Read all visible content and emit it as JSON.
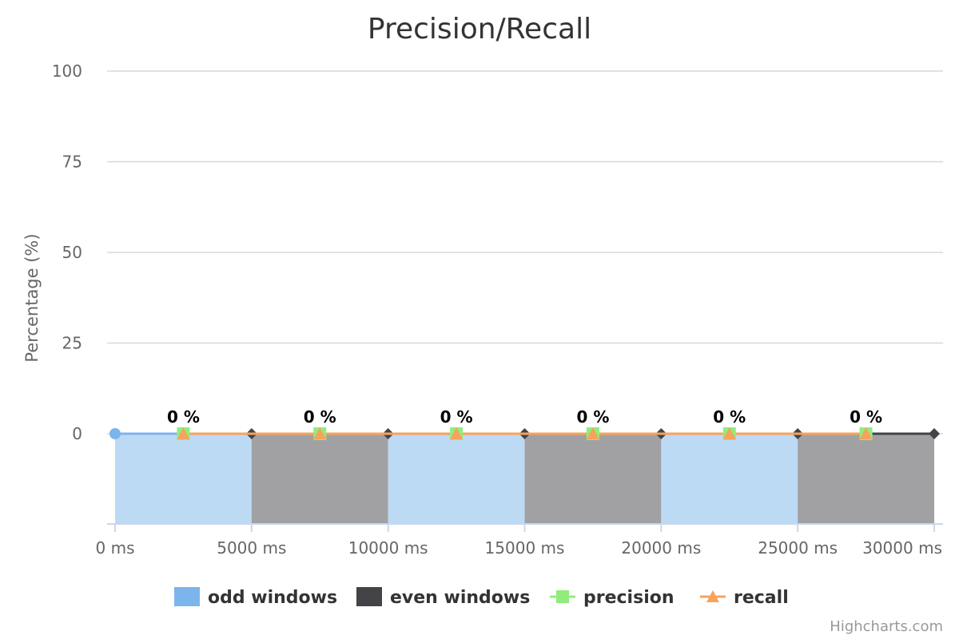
{
  "chart_data": {
    "type": "area",
    "title": "Precision/Recall",
    "ylabel": "Percentage (%)",
    "xlabel": "",
    "ylim": [
      0,
      100
    ],
    "xlim": [
      0,
      30000
    ],
    "y_ticks": [
      0,
      25,
      50,
      75,
      100
    ],
    "x_ticks": [
      0,
      5000,
      10000,
      15000,
      20000,
      25000,
      30000
    ],
    "x_unit": "ms",
    "x_tick_labels": [
      "0 ms",
      "5000 ms",
      "10000 ms",
      "15000 ms",
      "20000 ms",
      "25000 ms",
      "30000 ms"
    ],
    "grid": true,
    "legend_position": "bottom-center",
    "windows": [
      {
        "series": "odd windows",
        "start": 0,
        "end": 5000
      },
      {
        "series": "even windows",
        "start": 5000,
        "end": 10000
      },
      {
        "series": "odd windows",
        "start": 10000,
        "end": 15000
      },
      {
        "series": "even windows",
        "start": 15000,
        "end": 20000
      },
      {
        "series": "odd windows",
        "start": 20000,
        "end": 25000
      },
      {
        "series": "even windows",
        "start": 25000,
        "end": 30000
      }
    ],
    "window_points": [
      {
        "series": "odd windows",
        "x": 0,
        "y": 0
      },
      {
        "series": "even windows",
        "x": 5000,
        "y": 0
      },
      {
        "series": "even windows",
        "x": 10000,
        "y": 0
      },
      {
        "series": "even windows",
        "x": 15000,
        "y": 0
      },
      {
        "series": "even windows",
        "x": 20000,
        "y": 0
      },
      {
        "series": "even windows",
        "x": 25000,
        "y": 0
      },
      {
        "series": "even windows",
        "x": 30000,
        "y": 0
      }
    ],
    "series": [
      {
        "name": "odd windows",
        "color": "#7cb5ec",
        "marker": "square"
      },
      {
        "name": "even windows",
        "color": "#434348",
        "marker": "square"
      },
      {
        "name": "precision",
        "color": "#90ed7d",
        "marker": "square",
        "x": [
          2500,
          7500,
          12500,
          17500,
          22500,
          27500
        ],
        "values": [
          0,
          0,
          0,
          0,
          0,
          0
        ]
      },
      {
        "name": "recall",
        "color": "#f7a35c",
        "marker": "triangle",
        "x": [
          2500,
          7500,
          12500,
          17500,
          22500,
          27500
        ],
        "values": [
          0,
          0,
          0,
          0,
          0,
          0
        ]
      }
    ],
    "data_labels": [
      "0 %",
      "0 %",
      "0 %",
      "0 %",
      "0 %",
      "0 %"
    ],
    "credits": "Highcharts.com"
  }
}
